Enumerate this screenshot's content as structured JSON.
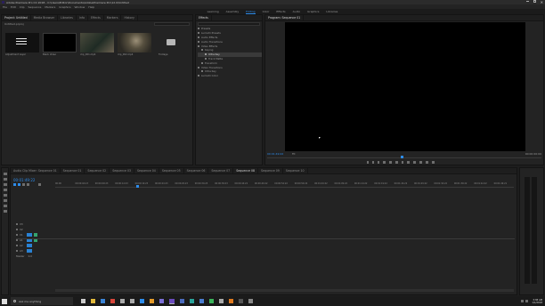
{
  "titlebar": {
    "title": "Adobe Premiere Pro CC 2018 - C:\\Users\\Editor\\Documents\\Adobe\\Premiere Pro\\12.0\\Untitled"
  },
  "menubar": {
    "items": [
      "File",
      "Edit",
      "Clip",
      "Sequence",
      "Markers",
      "Graphics",
      "Window",
      "Help"
    ]
  },
  "workspaces": {
    "items": [
      "Learning",
      "Assembly",
      "Editing",
      "Color",
      "Effects",
      "Audio",
      "Graphics",
      "Libraries"
    ],
    "active_index": 2
  },
  "project_panel": {
    "tabs": [
      "Project: Untitled",
      "Media Browser",
      "Libraries",
      "Info",
      "Effects",
      "Markers",
      "History"
    ],
    "path": "Untitled.prproj",
    "items": [
      {
        "name": "Adjustment Layer",
        "kind": "white-bars"
      },
      {
        "name": "Black Video",
        "kind": "black"
      },
      {
        "name": "clip_001.mp4",
        "kind": "photo-a"
      },
      {
        "name": "clip_002.mp4",
        "kind": "photo-b"
      },
      {
        "name": "Footage",
        "kind": "folder"
      }
    ]
  },
  "effects_panel": {
    "title": "Effects",
    "tree": [
      {
        "label": "Presets",
        "depth": 0
      },
      {
        "label": "Lumetri Presets",
        "depth": 0
      },
      {
        "label": "Audio Effects",
        "depth": 0
      },
      {
        "label": "Audio Transitions",
        "depth": 0
      },
      {
        "label": "Video Effects",
        "depth": 0
      },
      {
        "label": "Keying",
        "depth": 1
      },
      {
        "label": "Ultra Key",
        "depth": 2,
        "selected": true
      },
      {
        "label": "Track Matte",
        "depth": 2
      },
      {
        "label": "Transform",
        "depth": 1
      },
      {
        "label": "Video Transitions",
        "depth": 0
      },
      {
        "label": "Ultra Key",
        "depth": 1
      },
      {
        "label": "Lumetri Color",
        "depth": 0
      }
    ]
  },
  "program_monitor": {
    "title": "Program: Sequence 01",
    "timecode_left": "00:01:49:22",
    "timecode_right": "00:00:00:00",
    "fit": "Fit",
    "controls": [
      "mark-in-icon",
      "mark-out-icon",
      "go-to-in-icon",
      "step-back-icon",
      "play-icon",
      "step-forward-icon",
      "go-to-out-icon",
      "lift-icon",
      "extract-icon",
      "export-frame-icon",
      "compare-icon",
      "settings-icon"
    ]
  },
  "timeline": {
    "tabs": [
      "Audio Clip Mixer: Sequence 01",
      "Sequence 01",
      "Sequence 02",
      "Sequence 03",
      "Sequence 04",
      "Sequence 05",
      "Sequence 06",
      "Sequence 07",
      "Sequence 08",
      "Sequence 09",
      "Sequence 10"
    ],
    "active_tab": 8,
    "timecode": "00:01:49:22",
    "ruler": [
      "00:00",
      "00:00:04:23",
      "00:00:09:23",
      "00:00:14:23",
      "00:00:19:23",
      "00:00:24:23",
      "00:00:29:23",
      "00:00:34:23",
      "00:00:39:23",
      "00:00:44:22",
      "00:00:49:22",
      "00:00:54:22",
      "00:00:59:22",
      "00:01:04:22",
      "00:01:09:22",
      "00:01:14:22",
      "00:01:19:22",
      "00:01:24:22",
      "00:01:29:22",
      "00:01:34:22",
      "00:01:39:22",
      "00:01:44:22",
      "00:01:49:21"
    ],
    "tracks": [
      "V3",
      "V2",
      "V1",
      "A1",
      "A2",
      "A3",
      "Master"
    ],
    "master_value": "0.0"
  },
  "taskbar": {
    "search_text": "Ask me anything",
    "time": "3:38 AM",
    "date": "1/1/2018"
  },
  "colors": {
    "accent": "#2d8ceb",
    "panel": "#232323",
    "monitor": "#000000",
    "taskbar": "#1a1a1a"
  }
}
